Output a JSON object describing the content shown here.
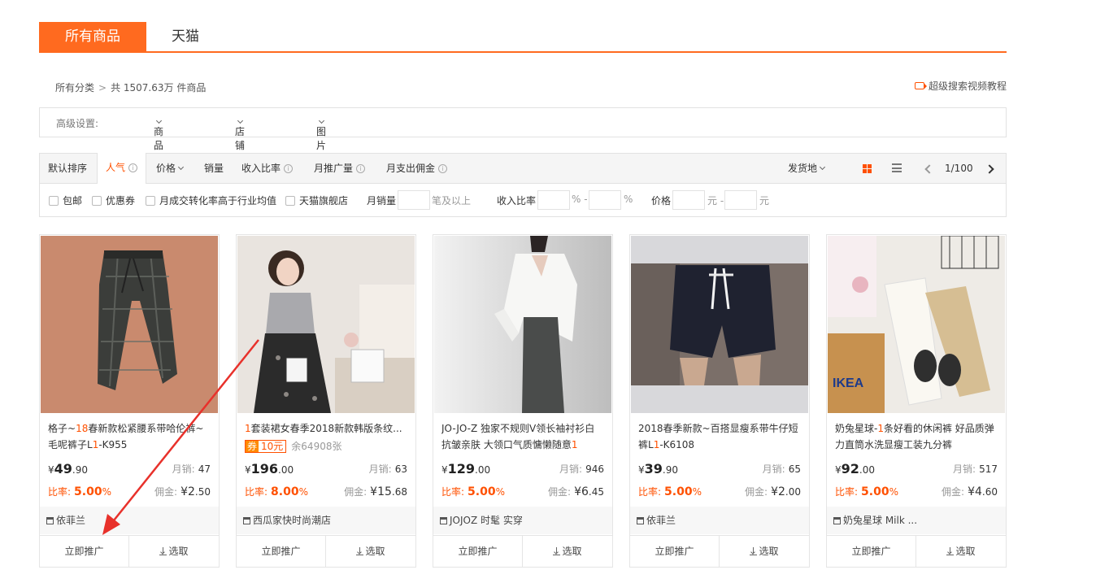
{
  "tabs": [
    "所有商品",
    "天猫"
  ],
  "breadcrumb": {
    "root": "所有分类",
    "sep": ">",
    "total": "共 1507.63万 件商品"
  },
  "video_link": "超级搜索视频教程",
  "advanced": {
    "label": "高级设置:",
    "goods": "商品要求",
    "shop": "店铺要求",
    "image": "图片要求"
  },
  "sort": {
    "default": "默认排序",
    "popular": "人气",
    "price": "价格",
    "sales": "销量",
    "income_rate": "收入比率",
    "monthly_promo": "月推广量",
    "monthly_comm": "月支出佣金",
    "ship_from": "发货地",
    "page": "1/100"
  },
  "filters": {
    "free_ship": "包邮",
    "coupon": "优惠券",
    "conversion": "月成交转化率高于行业均值",
    "tmall": "天猫旗舰店",
    "monthly_sales": "月销量",
    "above": "笔及以上",
    "income_rate": "收入比率",
    "pct1": "% -",
    "pct2": "%",
    "price": "价格",
    "yuan1": "元 -",
    "yuan2": "元"
  },
  "card_labels": {
    "sales": "月销:",
    "rate": "比率:",
    "comm": "佣金:",
    "promote": "立即推广",
    "pick": "选取",
    "yen": "¥"
  },
  "products": [
    {
      "title_pre": "格子~",
      "title_hl": "18",
      "title_mid": "春新款松紧腰系带哈伦裤~毛呢裤子L",
      "title_hl2": "1",
      "title_post": "-K955",
      "price_int": "49",
      "price_dec": ".90",
      "sales": "47",
      "rate": "5.00",
      "rate_pct": "%",
      "comm_int": "2",
      "comm_dec": ".50",
      "shop": "依菲兰"
    },
    {
      "title_pre": "",
      "title_hl": "1",
      "title_mid": "套装裙女春季2018新款韩版条纹...",
      "title_hl2": "",
      "title_post": "",
      "coupon_tag": "券",
      "coupon_value": "10元",
      "coupon_left": "余64908张",
      "price_int": "196",
      "price_dec": ".00",
      "sales": "63",
      "rate": "8.00",
      "rate_pct": "%",
      "comm_int": "15",
      "comm_dec": ".68",
      "shop": "西瓜家快时尚潮店"
    },
    {
      "title_pre": "JO-JO-Z 独家不规则V领长袖衬衫白抗皱亲肤 大领口气质慵懒随意",
      "title_hl": "1",
      "title_mid": "",
      "title_hl2": "",
      "title_post": "",
      "price_int": "129",
      "price_dec": ".00",
      "sales": "946",
      "rate": "5.00",
      "rate_pct": "%",
      "comm_int": "6",
      "comm_dec": ".45",
      "shop": "JOJOZ 时髦 实穿"
    },
    {
      "title_pre": "2018春季新款~百搭显瘦系带牛仔短裤L",
      "title_hl": "1",
      "title_mid": "-K6108",
      "title_hl2": "",
      "title_post": "",
      "price_int": "39",
      "price_dec": ".90",
      "sales": "65",
      "rate": "5.00",
      "rate_pct": "%",
      "comm_int": "2",
      "comm_dec": ".00",
      "shop": "依菲兰"
    },
    {
      "title_pre": "奶兔星球-",
      "title_hl": "1",
      "title_mid": "条好看的休闲裤 好品质弹力直筒水洗显瘦工装九分裤",
      "title_hl2": "",
      "title_post": "",
      "price_int": "92",
      "price_dec": ".00",
      "sales": "517",
      "rate": "5.00",
      "rate_pct": "%",
      "comm_int": "4",
      "comm_dec": ".60",
      "shop": "奶兔星球 Milk ..."
    }
  ],
  "colors": {
    "accent": "#ff6a1f",
    "price_red": "#ff5000",
    "arrow": "#e8312b"
  }
}
